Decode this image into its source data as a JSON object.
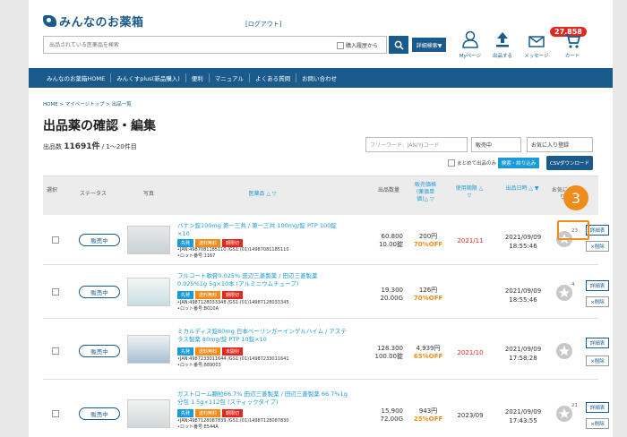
{
  "header": {
    "logo_text": "みんなのお薬箱",
    "logout": "[ログアウト]",
    "search_placeholder": "出品されている医薬品を検索",
    "purchase_history_label": "購入履歴から",
    "advanced_search_label": "詳細検索▼",
    "icons": [
      {
        "name": "mypage",
        "label": "Myページ"
      },
      {
        "name": "upload",
        "label": "出品する"
      },
      {
        "name": "message",
        "label": "メッセージ"
      },
      {
        "name": "cart",
        "label": "カート"
      }
    ],
    "message_badge": "27,858"
  },
  "nav": {
    "items": [
      "みんなのお薬箱HOME",
      "みんくすplus(新品購入)",
      "便利",
      "マニュアル",
      "よくある質問",
      "お問い合わせ"
    ]
  },
  "breadcrumb": "HOME > マイページトップ > 出品一覧",
  "page_title": "出品薬の確認・編集",
  "count_prefix": "出品数",
  "count_value": "11691件",
  "count_suffix": "/ 1〜20件目",
  "filters": {
    "keyword_placeholder": "フリーワード、JAN/YJコード",
    "status": "販売中",
    "favorite": "お気に入り登録",
    "bulk_label": "まとめて出品のみ",
    "sort_button": "検索・絞り込み",
    "csv_button": "CSVダウンロード"
  },
  "table": {
    "headers": {
      "select": "選択",
      "status": "ステータス",
      "photo": "写真",
      "name": "医薬品 △ ▽",
      "quantity": "出品数量",
      "price": "販売価格(薬価単価)△ ▽",
      "expiry": "使用期限 △ ▽",
      "date": "出品日時 △ ▼",
      "favorite": "お気に入り"
    },
    "rows": [
      {
        "status": "販売中",
        "name": "バナン錠100mg 第一三共 / 第一三共 100mg/錠 PTP 100錠×10",
        "tags": [
          "先発",
          "送料無料",
          "期限切"
        ],
        "jan": "•JAN:4987081185110 /GS1:(01)14987081185110",
        "lot": "•ロット番号:1167",
        "qty1": "60.800",
        "qty2": "10.00錠",
        "price1": "200円",
        "price2": "70%OFF",
        "expiry": "2021/11",
        "expiry_red": true,
        "date1": "2021/09/09",
        "date2": "18:55:46",
        "fav": "23",
        "edit": "詳細表",
        "del": "×削除"
      },
      {
        "status": "販売中",
        "name": "フルコート軟膏0.025% 田辺三菱製薬 / 田辺三菱製薬 0.025%1g 5g×10本 (アルミニウムチューブ)",
        "tags": [
          "先発",
          "送料無料",
          "期限切"
        ],
        "jan": "•JAN:4987128033348 /GS1:(01)14987128033345",
        "lot": "•ロット番号:B010A",
        "qty1": "19.300",
        "qty2": "20.00G",
        "price1": "126円",
        "price2": "70%OFF",
        "expiry": "",
        "expiry_red": false,
        "date1": "2021/09/09",
        "date2": "18:55:46",
        "fav": "4",
        "edit": "詳細表",
        "del": "×削除"
      },
      {
        "status": "販売中",
        "name": "ミカルディス錠80mg 日本ベーリンガーインゲルハイム / アステラス製薬 80mg/錠 PTP 10錠×10",
        "tags": [
          "先発",
          "送料無料",
          "未開封"
        ],
        "jan": "•JAN:4987233011644 /GS1:(01)14987233011641",
        "lot": "•ロット番号:889003",
        "qty1": "128.300",
        "qty2": "100.00錠",
        "price1": "4,939円",
        "price2": "65%OFF",
        "expiry": "2021/10",
        "expiry_red": true,
        "date1": "2021/09/09",
        "date2": "17:58:28",
        "fav": "",
        "edit": "詳細表",
        "del": "×削除"
      },
      {
        "status": "販売中",
        "name": "ガストローム顆粒66.7% 田辺三菱製薬 / 田辺三菱製薬 66.7%1g 分包 1.5g×112包 (スティックタイプ)",
        "tags": [
          "先発",
          "送料無料",
          "期限切"
        ],
        "jan": "•JAN:4987128087839 /GS1:(01)14987128087830",
        "lot": "•ロット番号:E544A",
        "qty1": "15.900",
        "qty2": "72.00G",
        "price1": "943円",
        "price2": "25%OFF",
        "expiry": "2023/09",
        "expiry_red": false,
        "date1": "2021/09/09",
        "date2": "17:43:55",
        "fav": "21",
        "edit": "詳細表",
        "del": "×削除"
      }
    ]
  },
  "step_marker": "3",
  "colors": {
    "brand": "#1a5b8c",
    "accent": "#1a9ad6",
    "orange": "#f08c1a",
    "red": "#e1281e"
  }
}
